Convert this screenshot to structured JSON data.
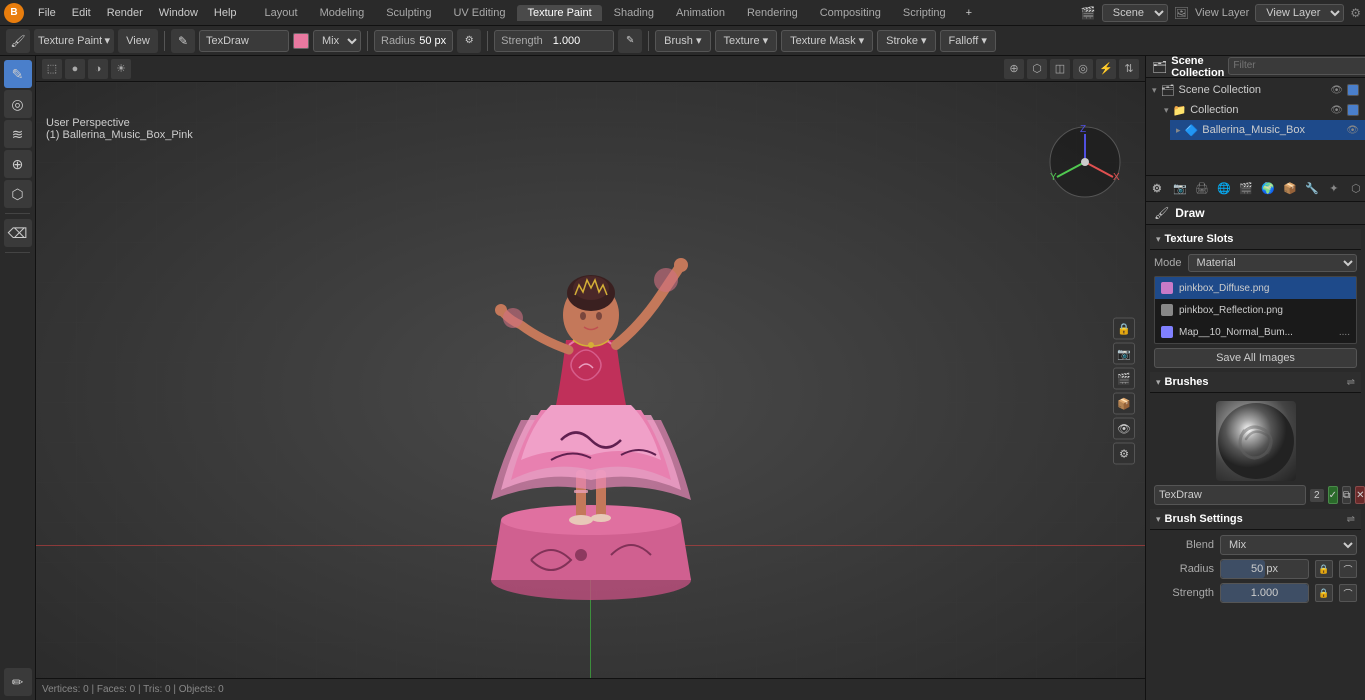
{
  "app": {
    "logo": "B",
    "logo_color": "#e87d0d"
  },
  "top_menu": {
    "items": [
      "File",
      "Edit",
      "Render",
      "Window",
      "Help"
    ]
  },
  "workspace_tabs": [
    {
      "label": "Layout",
      "active": false
    },
    {
      "label": "Modeling",
      "active": false
    },
    {
      "label": "Sculpting",
      "active": false
    },
    {
      "label": "UV Editing",
      "active": false
    },
    {
      "label": "Texture Paint",
      "active": true
    },
    {
      "label": "Shading",
      "active": false
    },
    {
      "label": "Animation",
      "active": false
    },
    {
      "label": "Rendering",
      "active": false
    },
    {
      "label": "Compositing",
      "active": false
    },
    {
      "label": "Scripting",
      "active": false
    }
  ],
  "top_right": {
    "plus_label": "+",
    "scene_label": "Scene",
    "view_layer_label": "View Layer"
  },
  "toolbar": {
    "brush_mode_icon": "🖌",
    "brush_name": "TexDraw",
    "color_label": "",
    "blend_mode": "Mix",
    "radius_label": "Radius",
    "radius_value": "50 px",
    "strength_label": "Strength",
    "strength_value": "1.000",
    "brush_btn": "Brush ▾",
    "texture_btn": "Texture ▾",
    "texture_mask_btn": "Texture Mask ▾",
    "stroke_btn": "Stroke ▾",
    "falloff_btn": "Falloff ▾",
    "color_picker_icon": "✎"
  },
  "viewport_header": {
    "mode_label": "Texture Paint",
    "view_btn": "View"
  },
  "viewport_info": {
    "perspective": "User Perspective",
    "object_name": "(1) Ballerina_Music_Box_Pink"
  },
  "outliner": {
    "title": "Scene Collection",
    "search_placeholder": "Filter",
    "items": [
      {
        "label": "Scene Collection",
        "icon": "🗂",
        "indent": 0,
        "expanded": true,
        "checked": true
      },
      {
        "label": "Collection",
        "icon": "📁",
        "indent": 1,
        "expanded": true,
        "checked": true
      },
      {
        "label": "Ballerina_Music_Box",
        "icon": "🔷",
        "indent": 2,
        "expanded": false,
        "checked": false,
        "highlighted": true
      }
    ]
  },
  "properties": {
    "icons": [
      "🖌",
      "⚙",
      "💡",
      "🌐",
      "📷",
      "📦",
      "⬡",
      "🔧",
      "🏔",
      "🎨",
      "🔲"
    ],
    "active_icon": 9
  },
  "texture_slots": {
    "title": "Texture Slots",
    "mode_label": "Mode",
    "mode_value": "Material",
    "slots": [
      {
        "name": "pinkbox_Diffuse.png",
        "color": "#c87ac8",
        "selected": true,
        "dots": ""
      },
      {
        "name": "pinkbox_Reflection.png",
        "color": "#888888",
        "dots": ""
      },
      {
        "name": "Map__10_Normal_Bum...",
        "color": "#8080ff",
        "dots": "...."
      }
    ],
    "save_btn": "Save All Images"
  },
  "brushes": {
    "title": "Brushes",
    "brush_name": "TexDraw",
    "brush_count": "2",
    "btn_check": "✓",
    "btn_copy": "⧉",
    "btn_close": "✕"
  },
  "brush_settings": {
    "title": "Brush Settings",
    "blend_label": "Blend",
    "blend_value": "Mix",
    "radius_label": "Radius",
    "radius_value": "50 px",
    "strength_label": "Strength",
    "strength_value": "1.000",
    "strength_pct": 100
  },
  "axis": {
    "x_color": "#e05050",
    "y_color": "#50c850",
    "z_color": "#5050e0"
  }
}
